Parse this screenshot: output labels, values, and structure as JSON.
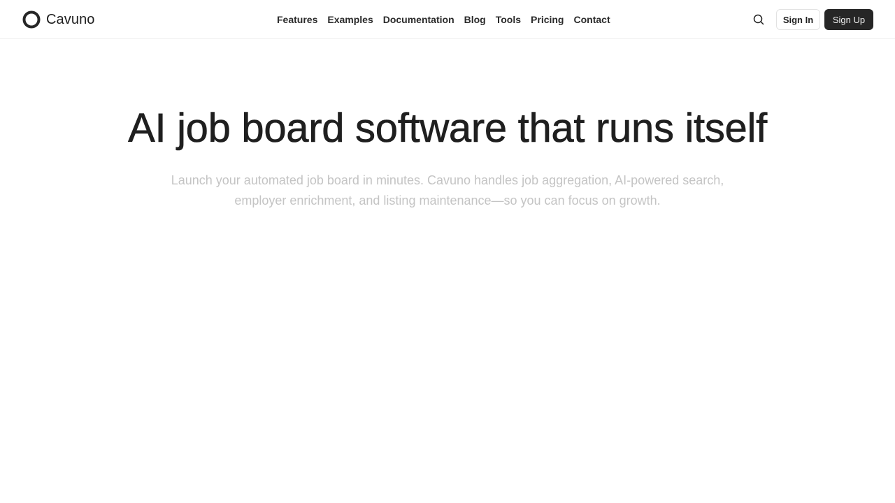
{
  "brand": {
    "name": "Cavuno",
    "logo_icon": "ring-logo-icon"
  },
  "nav": {
    "links": [
      {
        "label": "Features"
      },
      {
        "label": "Examples"
      },
      {
        "label": "Documentation"
      },
      {
        "label": "Blog"
      },
      {
        "label": "Tools"
      },
      {
        "label": "Pricing"
      },
      {
        "label": "Contact"
      }
    ]
  },
  "header_actions": {
    "search_icon": "search-icon",
    "sign_in_label": "Sign In",
    "sign_up_label": "Sign Up"
  },
  "hero": {
    "title": "AI job board software that runs itself",
    "subtitle": "Launch your automated job board in minutes. Cavuno handles job aggregation, AI-powered search, employer enrichment, and listing maintenance—so you can focus on growth."
  },
  "colors": {
    "text": "#1f1f1f",
    "subtitle": "#c4c4c4",
    "primary_button": "#262626",
    "border": "#e2e2e2"
  }
}
